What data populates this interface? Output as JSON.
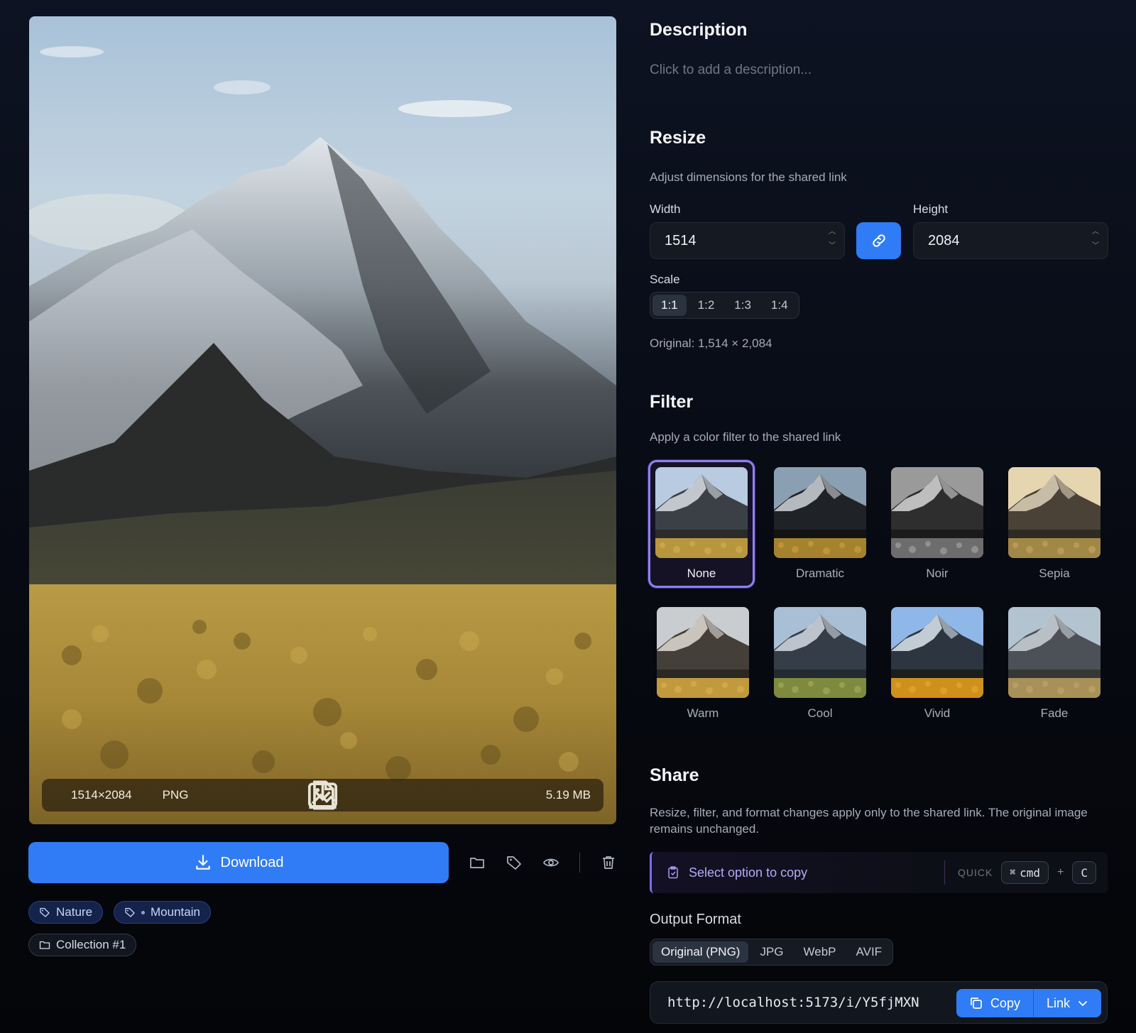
{
  "image": {
    "dimensions": "1514×2084",
    "format": "PNG",
    "size": "5.19 MB"
  },
  "actions": {
    "download_label": "Download",
    "icons": [
      "folder-icon",
      "tag-icon",
      "eye-icon",
      "trash-icon"
    ]
  },
  "tags": [
    "Nature",
    "Mountain"
  ],
  "collection": "Collection #1",
  "description": {
    "heading": "Description",
    "placeholder": "Click to add a description..."
  },
  "resize": {
    "heading": "Resize",
    "subtitle": "Adjust dimensions for the shared link",
    "width_label": "Width",
    "width_value": "1514",
    "height_label": "Height",
    "height_value": "2084",
    "scale_label": "Scale",
    "scale_options": [
      "1:1",
      "1:2",
      "1:3",
      "1:4"
    ],
    "scale_selected": "1:1",
    "original": "Original: 1,514 × 2,084"
  },
  "filter": {
    "heading": "Filter",
    "subtitle": "Apply a color filter to the shared link",
    "options": [
      "None",
      "Dramatic",
      "Noir",
      "Sepia",
      "Warm",
      "Cool",
      "Vivid",
      "Fade"
    ],
    "selected": "None"
  },
  "share": {
    "heading": "Share",
    "note": "Resize, filter, and format changes apply only to the shared link. The original image remains unchanged.",
    "copy_prompt": "Select option to copy",
    "quick_label": "QUICK",
    "shortcut_key1": "cmd",
    "shortcut_symbol": "⌘",
    "shortcut_plus": "+",
    "shortcut_key2": "C"
  },
  "output": {
    "heading": "Output Format",
    "options": [
      "Original (PNG)",
      "JPG",
      "WebP",
      "AVIF"
    ],
    "selected": "Original (PNG)",
    "url": "http://localhost:5173/i/Y5fjMXN",
    "copy_label": "Copy",
    "link_label": "Link"
  },
  "colors": {
    "accent": "#2f7cf6",
    "selection": "#8f7ff2"
  }
}
